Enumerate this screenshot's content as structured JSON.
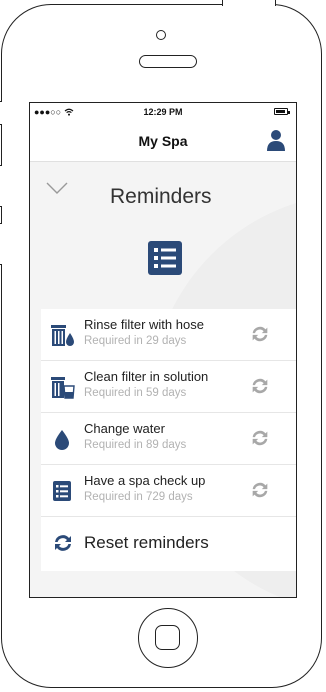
{
  "status_bar": {
    "signal": "●●●○○",
    "time": "12:29 PM"
  },
  "nav": {
    "title": "My Spa"
  },
  "section": {
    "title": "Reminders"
  },
  "reminders": [
    {
      "title": "Rinse filter with hose",
      "subtitle": "Required in 29 days",
      "icon": "filter-drop-icon"
    },
    {
      "title": "Clean filter in solution",
      "subtitle": "Required in 59 days",
      "icon": "filter-bucket-icon"
    },
    {
      "title": "Change water",
      "subtitle": "Required in 89 days",
      "icon": "water-drop-icon"
    },
    {
      "title": "Have a spa check up",
      "subtitle": "Required in 729 days",
      "icon": "checklist-icon"
    }
  ],
  "reset": {
    "label": "Reset reminders"
  },
  "colors": {
    "accent": "#2b4a78",
    "muted_icon": "#a8a8a8",
    "subtitle": "#b2b2b2"
  }
}
